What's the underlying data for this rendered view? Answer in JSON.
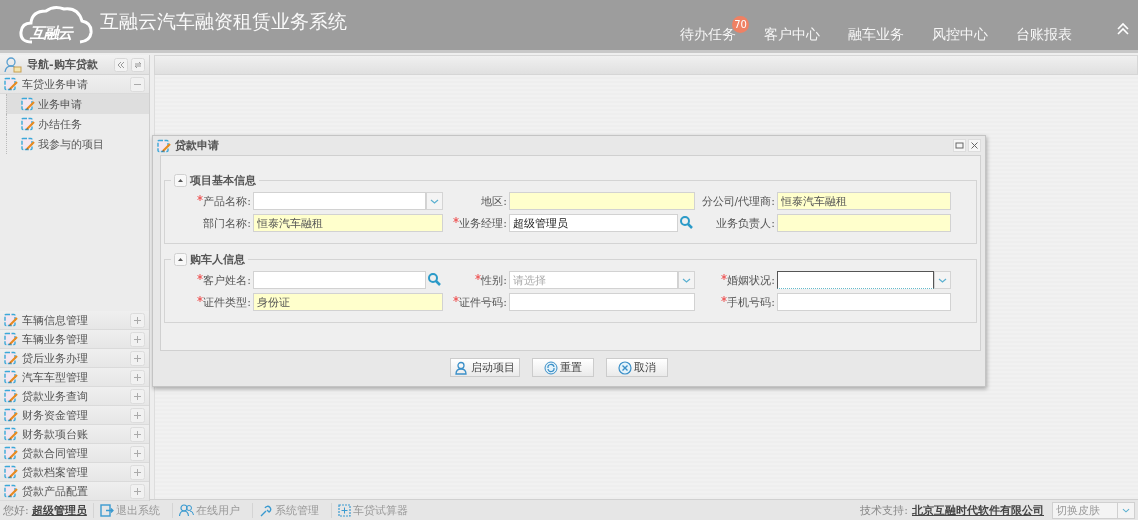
{
  "header": {
    "logo_text": "互融云",
    "app_title": "互融云汽车融资租赁业务系统",
    "nav": [
      {
        "label": "待办任务",
        "badge": "70"
      },
      {
        "label": "客户中心"
      },
      {
        "label": "融车业务"
      },
      {
        "label": "风控中心"
      },
      {
        "label": "台账报表"
      }
    ]
  },
  "sidebar": {
    "title": "导航-购车贷款",
    "sections": [
      {
        "label": "车贷业务申请",
        "expanded": true,
        "children": [
          {
            "label": "业务申请",
            "selected": true
          },
          {
            "label": "办结任务",
            "selected": false
          },
          {
            "label": "我参与的项目",
            "selected": false
          }
        ]
      },
      {
        "label": "车辆信息管理",
        "expanded": false
      },
      {
        "label": "车辆业务管理",
        "expanded": false
      },
      {
        "label": "贷后业务办理",
        "expanded": false
      },
      {
        "label": "汽车车型管理",
        "expanded": false
      },
      {
        "label": "贷款业务查询",
        "expanded": false
      },
      {
        "label": "财务资金管理",
        "expanded": false
      },
      {
        "label": "财务款项台账",
        "expanded": false
      },
      {
        "label": "贷款合同管理",
        "expanded": false
      },
      {
        "label": "贷款档案管理",
        "expanded": false
      },
      {
        "label": "贷款产品配置",
        "expanded": false
      }
    ]
  },
  "dialog": {
    "title": "贷款申请",
    "fieldsets": [
      {
        "legend": "项目基本信息",
        "expanded": true,
        "fields": [
          {
            "label": "产品名称:",
            "required": true,
            "kind": "select",
            "readonly": false,
            "focused": false
          },
          {
            "label": "地区:",
            "required": false,
            "kind": "text",
            "readonly": true,
            "focused": false
          },
          {
            "label": "分公司/代理商:",
            "required": false,
            "kind": "text",
            "readonly": true,
            "focused": false,
            "value": "恒泰汽车融租"
          },
          {
            "label": "部门名称:",
            "required": false,
            "kind": "text",
            "readonly": true,
            "focused": false,
            "value": "恒泰汽车融租"
          },
          {
            "label": "业务经理:",
            "required": true,
            "kind": "search",
            "readonly": false,
            "focused": false,
            "value": "超级管理员"
          },
          {
            "label": "业务负责人:",
            "required": false,
            "kind": "text",
            "readonly": true,
            "focused": false
          }
        ]
      },
      {
        "legend": "购车人信息",
        "expanded": true,
        "fields": [
          {
            "label": "客户姓名:",
            "required": true,
            "kind": "search",
            "readonly": false,
            "focused": false
          },
          {
            "label": "性别:",
            "required": true,
            "kind": "select",
            "readonly": false,
            "focused": false,
            "placeholder": "请选择"
          },
          {
            "label": "婚姻状况:",
            "required": true,
            "kind": "select",
            "readonly": false,
            "focused": true
          },
          {
            "label": "证件类型:",
            "required": true,
            "kind": "text",
            "readonly": true,
            "focused": false,
            "value": "身份证"
          },
          {
            "label": "证件号码:",
            "required": true,
            "kind": "text",
            "readonly": false,
            "focused": false
          },
          {
            "label": "手机号码:",
            "required": true,
            "kind": "text",
            "readonly": false,
            "focused": false
          }
        ]
      }
    ],
    "buttons": [
      "启动项目",
      "重置",
      "取消"
    ]
  },
  "status_bar": {
    "greeting": "您好:",
    "user": "超级管理员",
    "links": [
      "退出系统",
      "在线用户",
      "系统管理",
      "车贷试算器"
    ],
    "support_label": "技术支持:",
    "support_link": "北京互融时代软件有限公司",
    "skin_select": {
      "placeholder": "切换皮肤"
    }
  }
}
